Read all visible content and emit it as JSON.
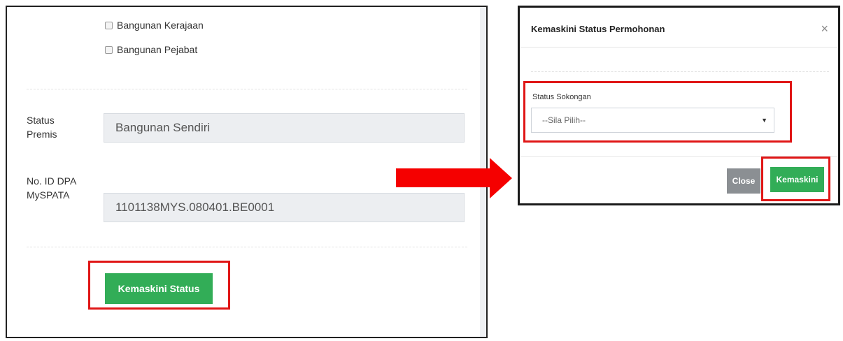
{
  "form": {
    "checkboxes": [
      {
        "label": "Bangunan Kerajaan",
        "checked": false
      },
      {
        "label": "Bangunan Pejabat",
        "checked": false
      }
    ],
    "fields": [
      {
        "label_line1": "Status",
        "label_line2": "Premis",
        "value": "Bangunan Sendiri"
      },
      {
        "label_line1": "No. ID DPA",
        "label_line2": "MySPATA",
        "value": "1101138MYS.080401.BE0001"
      }
    ],
    "update_status_button": "Kemaskini Status"
  },
  "modal": {
    "title": "Kemaskini Status Permohonan",
    "close_icon": "×",
    "select_label": "Status Sokongan",
    "select_value": "--Sila Pilih--",
    "select_caret": "▼",
    "close_button": "Close",
    "submit_button": "Kemaskini"
  },
  "colors": {
    "highlight": "#e01616",
    "arrow": "#f50000",
    "button_green": "#32ad57",
    "button_grey": "#8b8f93"
  }
}
